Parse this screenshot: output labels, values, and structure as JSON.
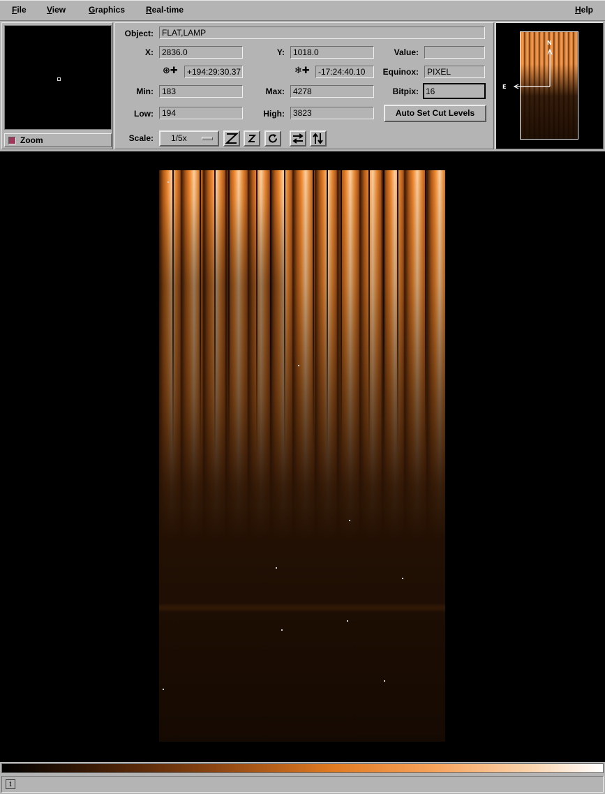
{
  "menu": {
    "file": "File",
    "view": "View",
    "graphics": "Graphics",
    "realtime": "Real-time",
    "help": "Help"
  },
  "zoom": {
    "label": "Zoom",
    "checked": true
  },
  "info": {
    "object_label": "Object:",
    "object_value": "FLAT,LAMP",
    "x_label": "X:",
    "x_value": "2836.0",
    "y_label": "Y:",
    "y_value": "1018.0",
    "value_label": "Value:",
    "value_value": "",
    "ra_value": "+194:29:30.37",
    "dec_value": "-17:24:40.10",
    "equinox_label": "Equinox:",
    "equinox_value": "PIXEL",
    "min_label": "Min:",
    "min_value": "183",
    "max_label": "Max:",
    "max_value": "4278",
    "bitpix_label": "Bitpix:",
    "bitpix_value": "16",
    "low_label": "Low:",
    "low_value": "194",
    "high_label": "High:",
    "high_value": "3823",
    "auto_cut_button": "Auto Set Cut Levels",
    "scale_label": "Scale:",
    "scale_value": "1/5x"
  },
  "toolbar": {
    "icons": [
      "zoom-in-icon",
      "zoom-out-icon",
      "rotate-icon",
      "flip-x-icon",
      "flip-y-icon"
    ]
  },
  "pan": {
    "north_label": "N",
    "east_label": "E"
  },
  "colors": {
    "panel_bg": "#b4b4b4",
    "canvas_bg": "#000000",
    "image_accent": "#f08a30",
    "zoom_check": "#a0385a"
  }
}
